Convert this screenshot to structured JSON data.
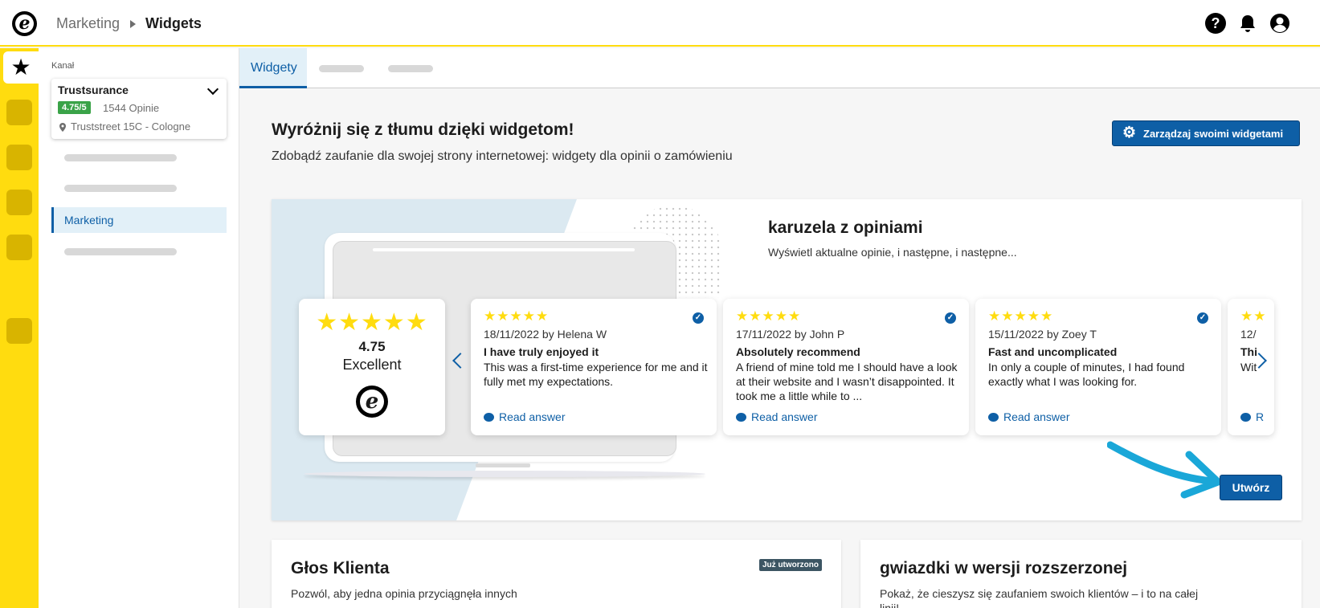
{
  "topbar": {
    "logo_letter": "e",
    "breadcrumb_parent": "Marketing",
    "breadcrumb_current": "Widgets",
    "help_glyph": "?",
    "bell_glyph": "🔔",
    "account_glyph": "👤"
  },
  "rail": {
    "active_icon": "star-icon",
    "active_glyph": "★",
    "accent_color": "#ffdc0f"
  },
  "sidebar": {
    "channel_label": "Kanał",
    "channel": {
      "name": "Trustsurance",
      "rating": "4.75/5",
      "reviews": "1544 Opinie",
      "address": "Truststreet 15C - Cologne"
    },
    "active_item": "Marketing"
  },
  "tabs": {
    "active": "Widgety"
  },
  "header": {
    "title": "Wyróżnij się z tłumu dzięki widgetom!",
    "subtitle": "Zdobądź zaufanie dla swojej strony internetowej: widgety dla opinii o zamówieniu",
    "manage_button": "Zarządzaj swoimi widgetami"
  },
  "hero": {
    "title": "karuzela z opiniami",
    "subtitle": "Wyświetl aktualne opinie, i następne, i następne...",
    "score": {
      "stars": "★★★★★",
      "value": "4.75",
      "label": "Excellent"
    },
    "reviews": [
      {
        "stars": "★★★★★",
        "meta": "18/11/2022 by Helena W",
        "title": "I have truly enjoyed it",
        "body": "This was a first-time experience for me and it fully met my expectations.",
        "action": "Read answer"
      },
      {
        "stars": "★★★★★",
        "meta": "17/11/2022 by John P",
        "title": "Absolutely recommend",
        "body": "A friend of mine told me I should have a look at their website and I wasn’t disappointed. It took me a little while to ...",
        "action": "Read answer"
      },
      {
        "stars": "★★★★★",
        "meta": "15/11/2022 by Zoey T",
        "title": "Fast and uncomplicated",
        "body": "In only a couple of minutes, I had found exactly what I was looking for.",
        "action": "Read answer"
      },
      {
        "stars": "★★",
        "meta": "12/",
        "title": "Thi",
        "body": "Wit",
        "action": "R"
      }
    ],
    "create_button": "Utwórz"
  },
  "cards": [
    {
      "title": "Głos Klienta",
      "subtitle": "Pozwól, aby jedna opinia przyciągnęła innych",
      "badge": "Już utworzono"
    },
    {
      "title": "gwiazdki w wersji rozszerzonej",
      "subtitle": "Pokaż, że cieszysz się zaufaniem swoich klientów – i to na całej linii!"
    }
  ]
}
